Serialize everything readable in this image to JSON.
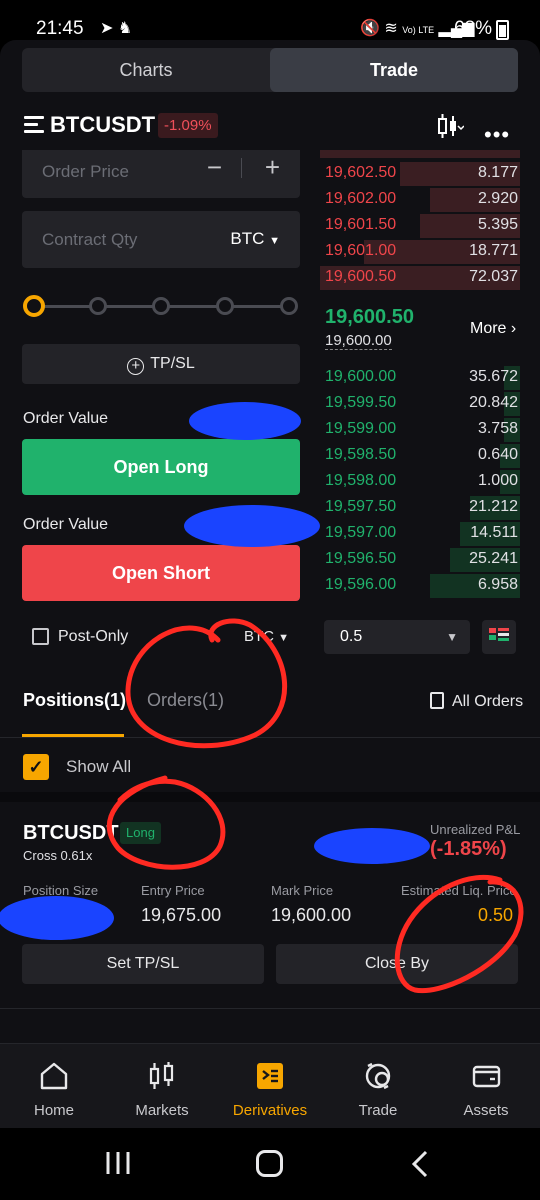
{
  "status": {
    "time": "21:45",
    "network": "Vo) LTE",
    "battery": "68%"
  },
  "tabs": {
    "charts": "Charts",
    "trade": "Trade"
  },
  "header": {
    "pair": "BTCUSDT",
    "change": "-1.09%"
  },
  "form": {
    "order_price_placeholder": "Order Price",
    "contract_qty_placeholder": "Contract Qty",
    "qty_unit": "BTC",
    "tpsl_label": "TP/SL",
    "order_value_label": "Order Value",
    "open_long": "Open Long",
    "open_short": "Open Short",
    "post_only": "Post-Only",
    "bottom_unit": "BTC"
  },
  "orderbook": {
    "asks": [
      {
        "price": "19,602.50",
        "qty": "8.177",
        "depth": 0.6
      },
      {
        "price": "19,602.00",
        "qty": "2.920",
        "depth": 0.45
      },
      {
        "price": "19,601.50",
        "qty": "5.395",
        "depth": 0.5
      },
      {
        "price": "19,601.00",
        "qty": "18.771",
        "depth": 0.78
      },
      {
        "price": "19,600.50",
        "qty": "72.037",
        "depth": 1.0
      }
    ],
    "last_price": "19,600.50",
    "mark_price": "19,600.00",
    "more": "More",
    "bids": [
      {
        "price": "19,600.00",
        "qty": "35.672",
        "depth": 0.08
      },
      {
        "price": "19,599.50",
        "qty": "20.842",
        "depth": 0.08
      },
      {
        "price": "19,599.00",
        "qty": "3.758",
        "depth": 0.08
      },
      {
        "price": "19,598.50",
        "qty": "0.640",
        "depth": 0.1
      },
      {
        "price": "19,598.00",
        "qty": "1.000",
        "depth": 0.1
      },
      {
        "price": "19,597.50",
        "qty": "21.212",
        "depth": 0.25
      },
      {
        "price": "19,597.00",
        "qty": "14.511",
        "depth": 0.3
      },
      {
        "price": "19,596.50",
        "qty": "25.241",
        "depth": 0.35
      },
      {
        "price": "19,596.00",
        "qty": "6.958",
        "depth": 0.45
      }
    ],
    "depth_value": "0.5"
  },
  "positions": {
    "tab_positions": "Positions(1)",
    "tab_orders": "Orders(1)",
    "all_orders": "All Orders",
    "show_all": "Show All",
    "symbol": "BTCUSDT",
    "side": "Long",
    "margin": "Cross 0.61x",
    "upnl_label": "Unrealized P&L",
    "upnl_value": "(-1.85%)",
    "col_size": "Position Size",
    "col_entry": "Entry Price",
    "col_mark": "Mark Price",
    "col_liq": "Estimated Liq. Price",
    "entry_price": "19,675.00",
    "mark_price": "19,600.00",
    "liq_price": "0.50",
    "set_tpsl": "Set TP/SL",
    "close_by": "Close By"
  },
  "nav": {
    "home": "Home",
    "markets": "Markets",
    "derivatives": "Derivatives",
    "trade": "Trade",
    "assets": "Assets"
  },
  "colors": {
    "accent": "#f7a600",
    "buy": "#20b26c",
    "sell": "#ef454a"
  }
}
